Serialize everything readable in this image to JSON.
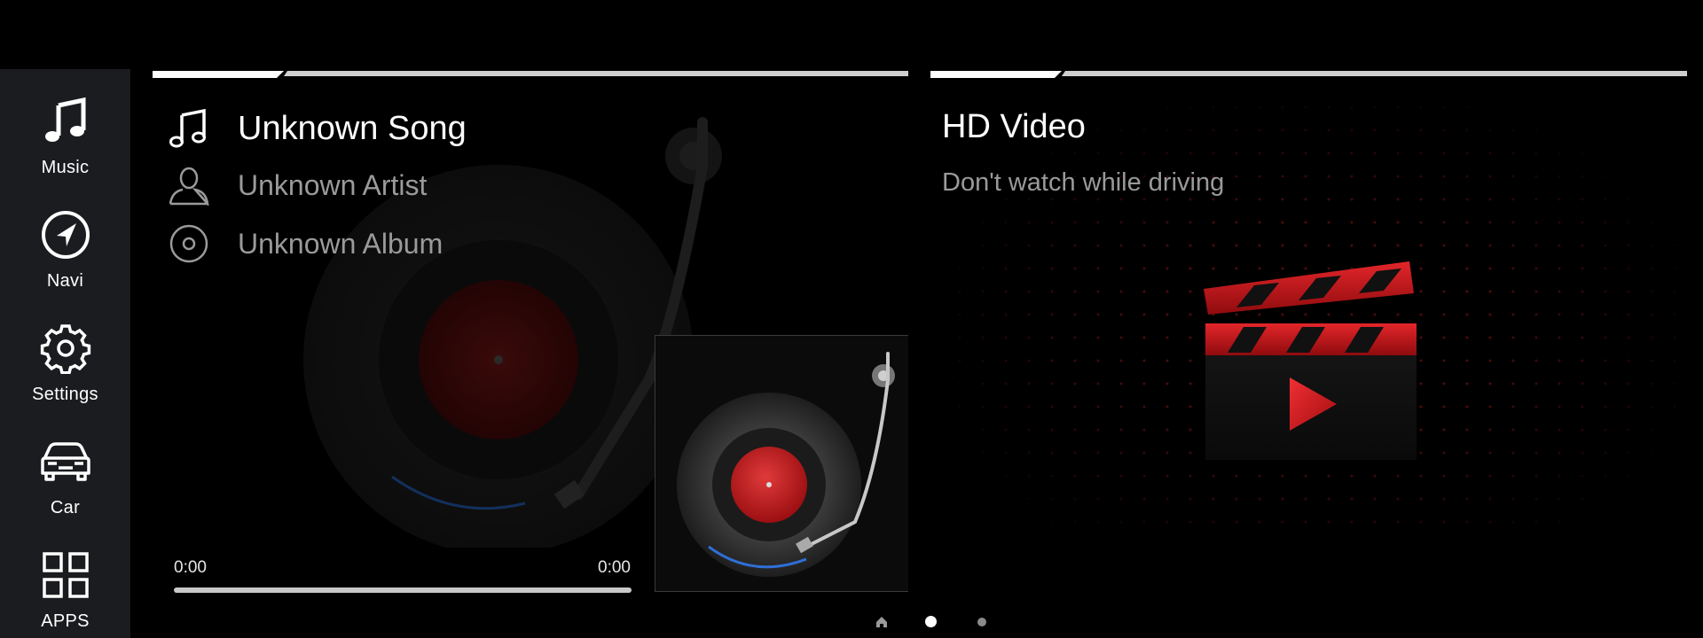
{
  "sidebar": {
    "items": [
      {
        "label": "Music",
        "icon": "music-note-icon"
      },
      {
        "label": "Navi",
        "icon": "navigation-arrow-icon"
      },
      {
        "label": "Settings",
        "icon": "gear-icon"
      },
      {
        "label": "Car",
        "icon": "car-icon"
      },
      {
        "label": "APPS",
        "icon": "grid-apps-icon"
      }
    ]
  },
  "music": {
    "song": "Unknown Song",
    "artist": "Unknown Artist",
    "album": "Unknown Album",
    "current_time": "0:00",
    "total_time": "0:00",
    "progress": 0
  },
  "video": {
    "title": "HD Video",
    "subtitle": "Don't watch while driving"
  },
  "pager": {
    "page_count": 2,
    "active_page": 1
  },
  "colors": {
    "accent_red": "#c8191b",
    "sidebar_bg": "#1b1c1f",
    "secondary_text": "#9a9a9a",
    "record_glow_blue": "#2f6fd6"
  }
}
